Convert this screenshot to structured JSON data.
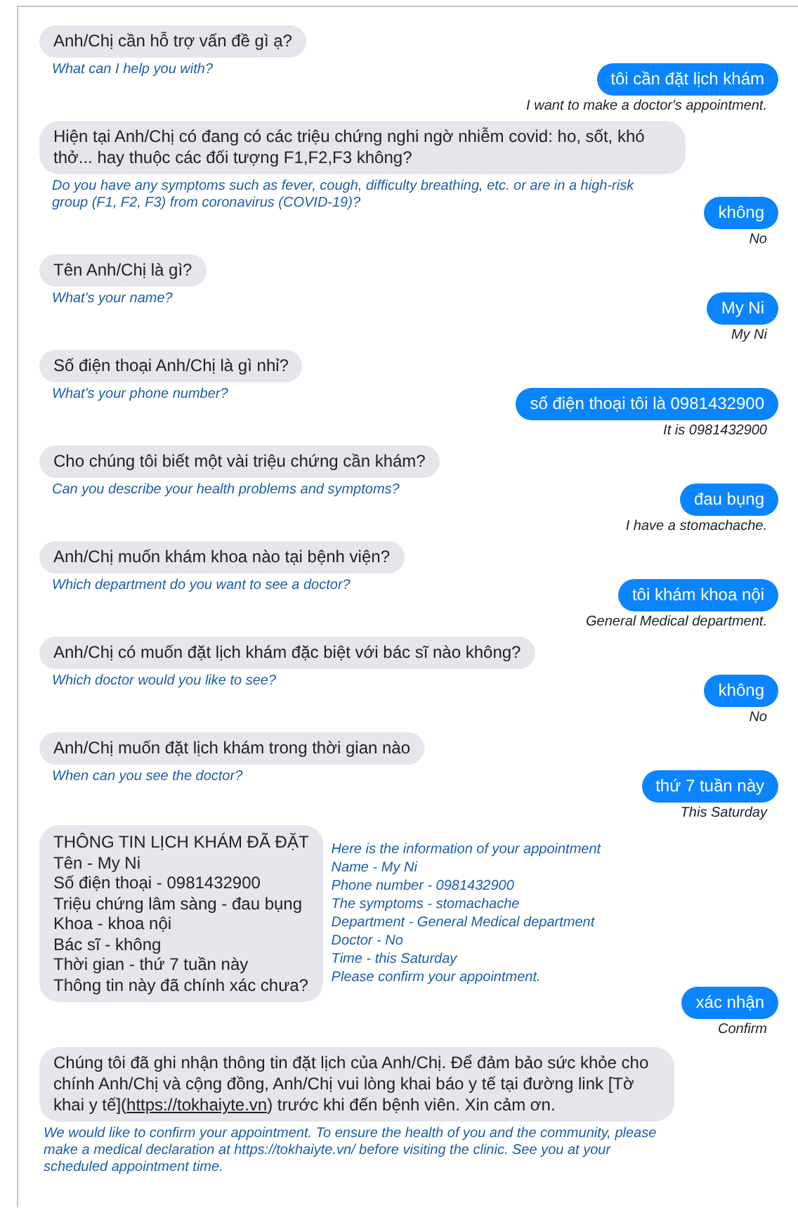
{
  "messages": [
    {
      "kind": "bot",
      "text": "Anh/Chị cần hỗ trợ vấn đề gì ạ?",
      "translation": "What can I help you with?"
    },
    {
      "kind": "user",
      "text": "tôi cần đặt lịch khám",
      "translation": "I want to make a doctor's appointment."
    },
    {
      "kind": "bot",
      "text": "Hiện tại Anh/Chị có đang có các triệu chứng nghi ngờ nhiễm covid: ho, sốt, khó thở... hay thuộc các đối tượng F1,F2,F3 không?",
      "translation": "Do you have any symptoms such as fever, cough, difficulty breathing, etc. or are in a high-risk group (F1, F2, F3) from coronavirus (COVID-19)?"
    },
    {
      "kind": "user",
      "text": "không",
      "translation": "No"
    },
    {
      "kind": "bot",
      "text": "Tên Anh/Chị là gì?",
      "translation": "What's your name?"
    },
    {
      "kind": "user",
      "text": "My Ni",
      "translation": "My Ni"
    },
    {
      "kind": "bot",
      "text": "Số điện thoại Anh/Chị là gì nhỉ?",
      "translation": "What's your phone number?"
    },
    {
      "kind": "user",
      "text": "số điện thoại tôi là 0981432900",
      "translation": "It is 0981432900"
    },
    {
      "kind": "bot",
      "text": "Cho chúng tôi biết một vài triệu chứng cần khám?",
      "translation": "Can you describe your health problems and symptoms?"
    },
    {
      "kind": "user",
      "text": "đau bụng",
      "translation": "I have a stomachache."
    },
    {
      "kind": "bot",
      "text": "Anh/Chị muốn khám khoa nào tại bệnh viện?",
      "translation": "Which department do you want to see a doctor?"
    },
    {
      "kind": "user",
      "text": "tôi khám khoa nội",
      "translation": "General Medical department."
    },
    {
      "kind": "bot",
      "text": "Anh/Chị có muốn đặt lịch khám đặc biệt với bác sĩ nào không?",
      "translation": "Which doctor would you like to see?"
    },
    {
      "kind": "user",
      "text": "không",
      "translation": "No"
    },
    {
      "kind": "bot",
      "text": "Anh/Chị muốn đặt lịch khám trong thời gian nào",
      "translation": "When can you see the doctor?"
    },
    {
      "kind": "user",
      "text": "thứ 7 tuần này",
      "translation": "This Saturday"
    },
    {
      "kind": "summary",
      "lines": [
        "THÔNG TIN LỊCH KHÁM ĐÃ ĐẶT",
        "Tên - My Ni",
        "Số điện thoại - 0981432900",
        "Triệu chứng lâm sàng - đau bụng",
        "Khoa - khoa nội",
        "Bác sĩ - không",
        "Thời gian - thứ 7 tuần này",
        "Thông tin này đã chính xác chưa?"
      ],
      "translation_lines": [
        "Here is the information of your appointment",
        "Name - My Ni",
        "Phone number - 0981432900",
        "The symptoms - stomachache",
        "Department - General Medical department",
        "Doctor - No",
        "Time - this Saturday",
        "Please confirm your appointment."
      ]
    },
    {
      "kind": "user",
      "text": "xác nhận",
      "translation": "Confirm"
    },
    {
      "kind": "bot_link",
      "text_before": "Chúng tôi đã ghi nhận thông tin đặt lịch của Anh/Chị. Để đảm bảo sức khỏe cho chính Anh/Chị và cộng đồng, Anh/Chị vui lòng khai báo y tế tại đường link [Tờ khai y tế](",
      "link": "https://tokhaiyte.vn",
      "text_after": ") trước khi đến bệnh viên. Xin cảm ơn.",
      "translation": "We would like to confirm your appointment. To ensure the health of you and the community, please make a medical declaration at https://tokhaiyte.vn/ before visiting the clinic. See you at your scheduled appointment time."
    }
  ]
}
